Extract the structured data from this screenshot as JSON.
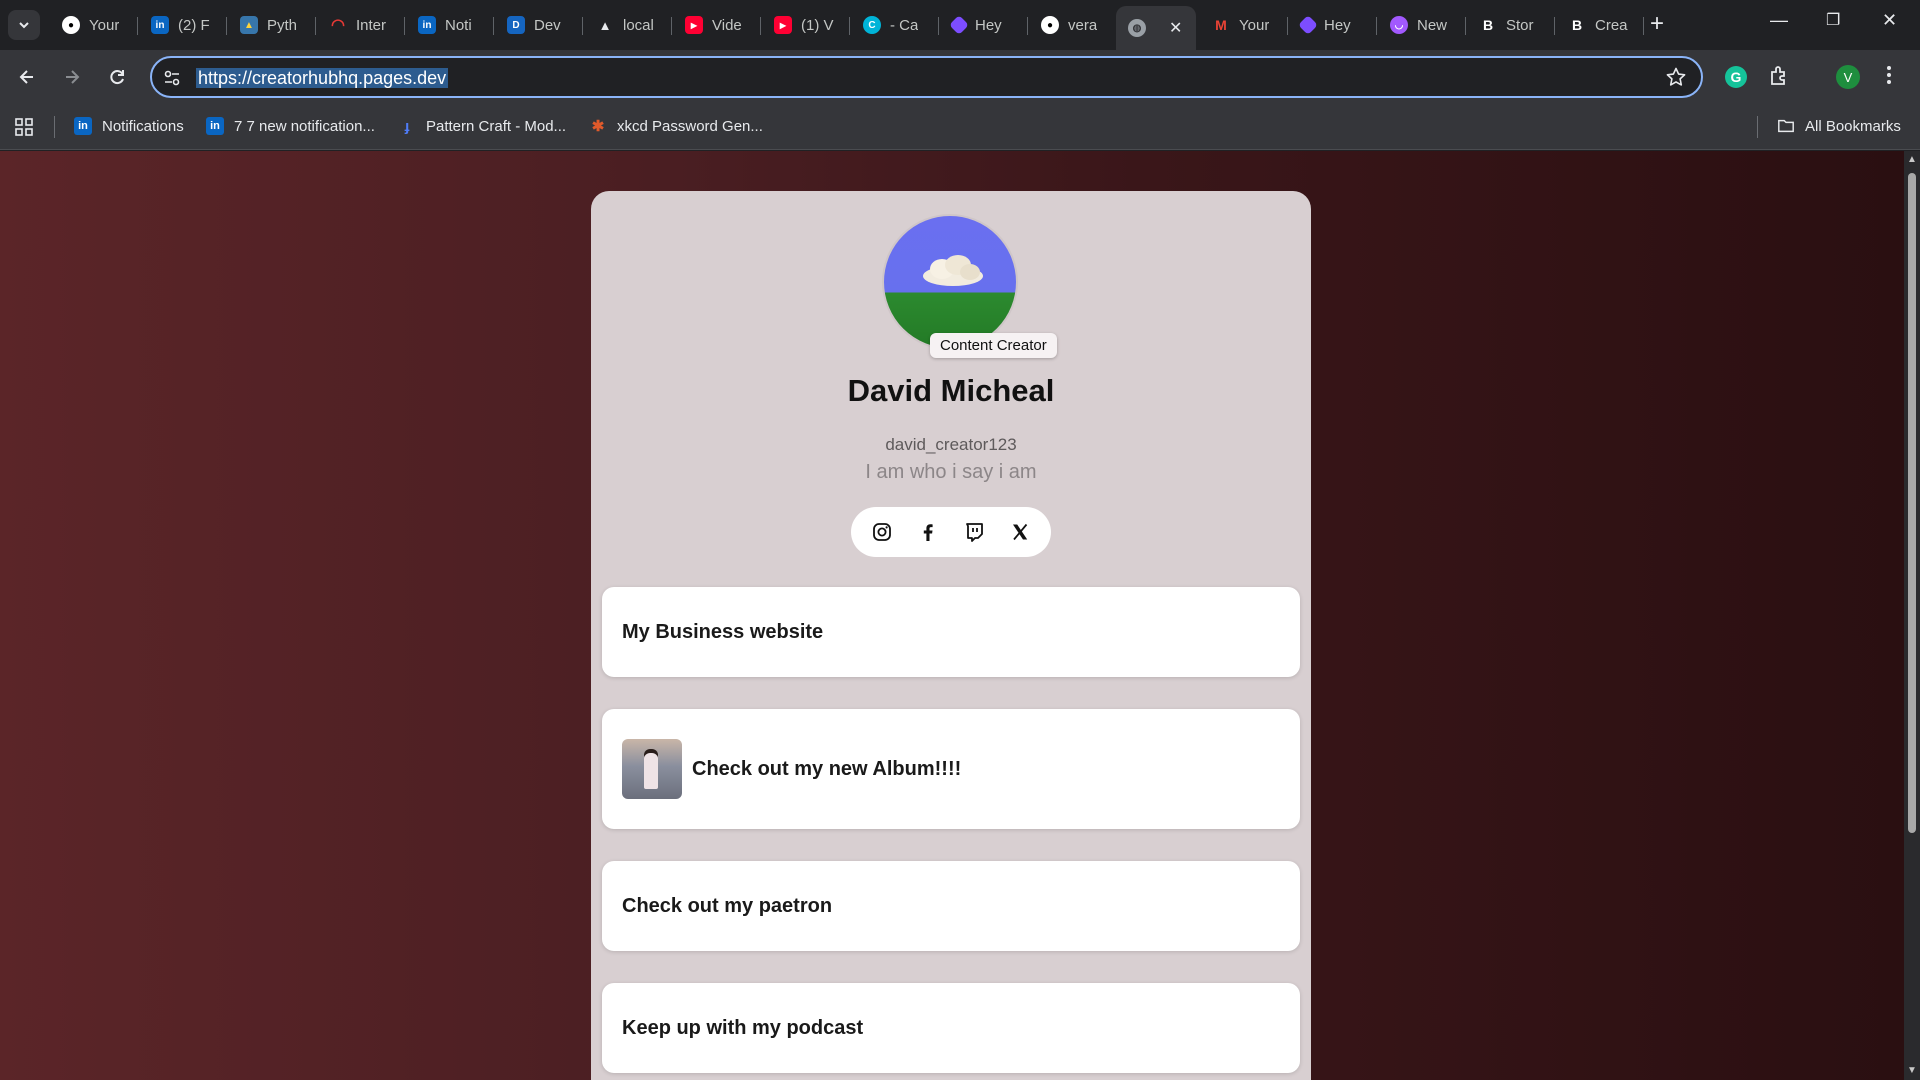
{
  "browser": {
    "tabs": [
      {
        "title": "Your",
        "icon": "github-icon",
        "color": "#ffffff"
      },
      {
        "title": "(2) F",
        "icon": "linkedin-icon",
        "color": "#0a66c2"
      },
      {
        "title": "Pyth",
        "icon": "python-icon",
        "color": "#f0b429"
      },
      {
        "title": "Inter",
        "icon": "arc-icon",
        "color": "#e53935"
      },
      {
        "title": "Noti",
        "icon": "linkedin-icon",
        "color": "#0a66c2"
      },
      {
        "title": "Dev",
        "icon": "d-icon",
        "color": "#1565c0"
      },
      {
        "title": "local",
        "icon": "triangle-icon",
        "color": "#9e9e9e"
      },
      {
        "title": "Vide",
        "icon": "youtube-icon",
        "color": "#ff0033"
      },
      {
        "title": "(1) V",
        "icon": "youtube-icon",
        "color": "#ff0033"
      },
      {
        "title": "- Ca",
        "icon": "c-icon",
        "color": "#00b4d8"
      },
      {
        "title": "Hey",
        "icon": "heygen-icon",
        "color": "#7c4dff"
      },
      {
        "title": "vera",
        "icon": "github-icon",
        "color": "#ffffff"
      },
      {
        "title": "",
        "icon": "globe-icon",
        "color": "#9aa0a6",
        "active": true
      },
      {
        "title": "Your",
        "icon": "gmail-icon",
        "color": "#ea4335"
      },
      {
        "title": "Hey",
        "icon": "heygen-icon",
        "color": "#7c4dff"
      },
      {
        "title": "New",
        "icon": "circle-icon",
        "color": "#a259ff"
      },
      {
        "title": "Stor",
        "icon": "b-icon",
        "color": "#ffffff"
      },
      {
        "title": "Crea",
        "icon": "b-icon",
        "color": "#ffffff"
      }
    ],
    "url": "https://creatorhubhq.pages.dev",
    "profile_initial": "V",
    "bookmarks": [
      {
        "label": "Notifications",
        "icon": "linkedin-icon"
      },
      {
        "label": "7 7 new notification...",
        "icon": "linkedin-icon"
      },
      {
        "label": "Pattern Craft - Mod...",
        "icon": "pattern-icon"
      },
      {
        "label": "xkcd Password Gen...",
        "icon": "xkcd-icon"
      }
    ],
    "all_bookmarks": "All Bookmarks"
  },
  "profile": {
    "role": "Content Creator",
    "name": "David Micheal",
    "handle": "david_creator123",
    "bio": "I am who i say i am",
    "socials": [
      "instagram-icon",
      "facebook-icon",
      "twitch-icon",
      "x-icon"
    ]
  },
  "links": [
    {
      "label": "My Business website",
      "has_thumb": false
    },
    {
      "label": "Check out my new Album!!!!",
      "has_thumb": true
    },
    {
      "label": "Check out my paetron",
      "has_thumb": false
    },
    {
      "label": "Keep up with my podcast",
      "has_thumb": false
    }
  ],
  "colors": {
    "accent": "#8ab4f8",
    "page_gradient_start": "#5b2528",
    "page_gradient_end": "#2a0f11",
    "card_bg": "#d8cfd1"
  }
}
